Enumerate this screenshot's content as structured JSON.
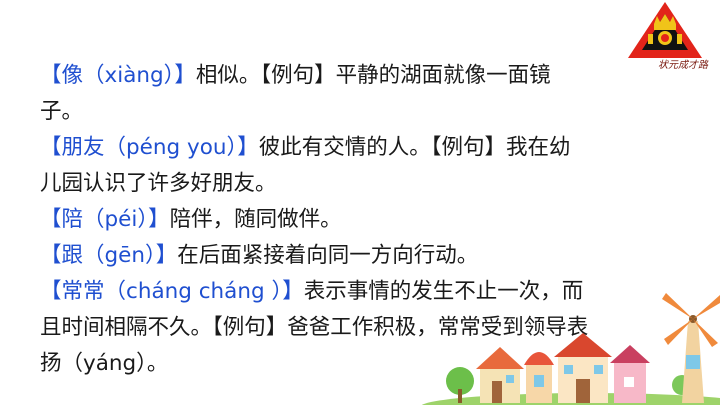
{
  "logo": {
    "caption": "状元成才路",
    "icon": "crown-badge-icon",
    "colors": {
      "badge": "#e2241a",
      "dark": "#111111",
      "crown": "#f0c419"
    }
  },
  "entries": [
    {
      "lines": [
        {
          "term": "【像（xiàng）】",
          "def": "相似。【例句】平静的湖面就像一面镜"
        },
        {
          "term": "",
          "def": "子。"
        }
      ]
    },
    {
      "lines": [
        {
          "term": "【朋友（péng you）】",
          "def": "彼此有交情的人。【例句】我在幼"
        },
        {
          "term": "",
          "def": "儿园认识了许多好朋友。"
        }
      ]
    },
    {
      "lines": [
        {
          "term": "【陪（péi）】",
          "def": "陪伴，随同做伴。"
        }
      ]
    },
    {
      "lines": [
        {
          "term": "【跟（gēn）】",
          "def": "在后面紧接着向同一方向行动。"
        }
      ]
    },
    {
      "lines": [
        {
          "term": "【常常（cháng cháng ）】",
          "def": "表示事情的发生不止一次，而"
        },
        {
          "term": "",
          "def": "且时间相隔不久。【例句】爸爸工作积极，常常受到领导表"
        },
        {
          "term": "",
          "def": "扬（yáng）。"
        }
      ]
    }
  ],
  "colors": {
    "term": "#1f4fd0",
    "text": "#1a1a1a"
  }
}
